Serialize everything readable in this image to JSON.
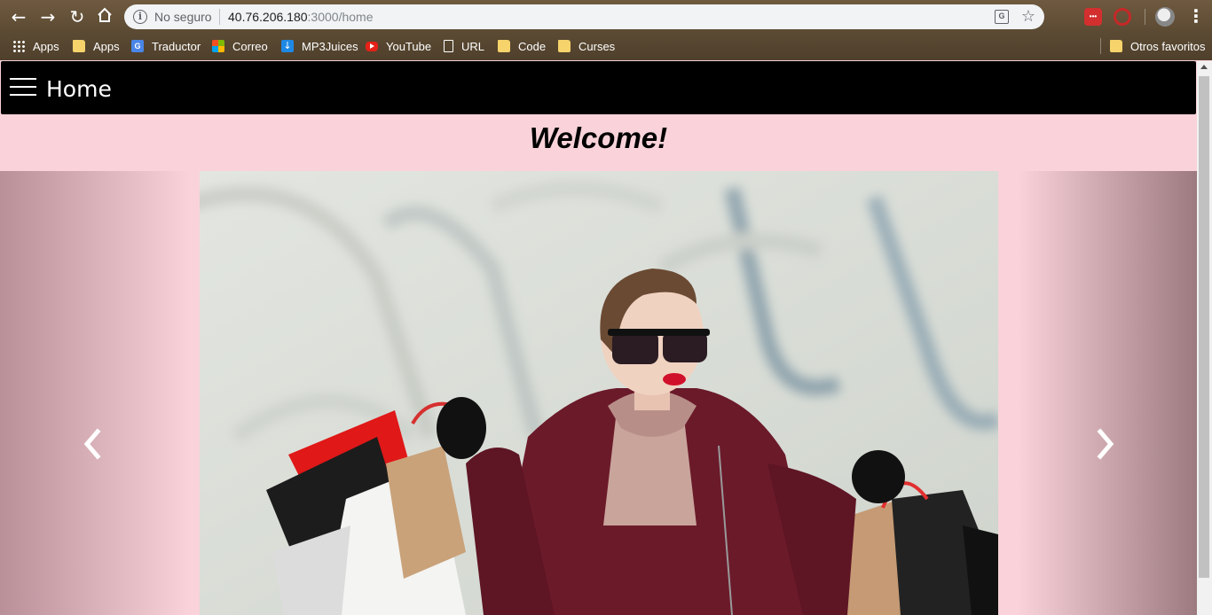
{
  "browser": {
    "security_label": "No seguro",
    "url_host": "40.76.206.180",
    "url_path": ":3000/home",
    "extension_badge": "•••"
  },
  "bookmarks": [
    {
      "label": "Apps",
      "icon": "apps-grid-icon"
    },
    {
      "label": "Apps",
      "icon": "folder-icon"
    },
    {
      "label": "Traductor",
      "icon": "google-translate-icon"
    },
    {
      "label": "Correo",
      "icon": "microsoft-icon"
    },
    {
      "label": "MP3Juices",
      "icon": "download-icon"
    },
    {
      "label": "YouTube",
      "icon": "youtube-icon"
    },
    {
      "label": "URL",
      "icon": "page-icon"
    },
    {
      "label": "Code",
      "icon": "folder-icon"
    },
    {
      "label": "Curses",
      "icon": "folder-icon"
    }
  ],
  "other_bookmarks": "Otros favoritos",
  "app": {
    "title": "Home",
    "welcome": "Welcome!"
  },
  "colors": {
    "page_background": "#f9d3d9",
    "appbar": "#000000",
    "coat": "#6b1a2a",
    "lipstick": "#d0102a"
  },
  "carousel": {
    "slide_image": "woman-with-shopping-bags-photo",
    "prev_icon": "chevron-left-icon",
    "next_icon": "chevron-right-icon"
  }
}
